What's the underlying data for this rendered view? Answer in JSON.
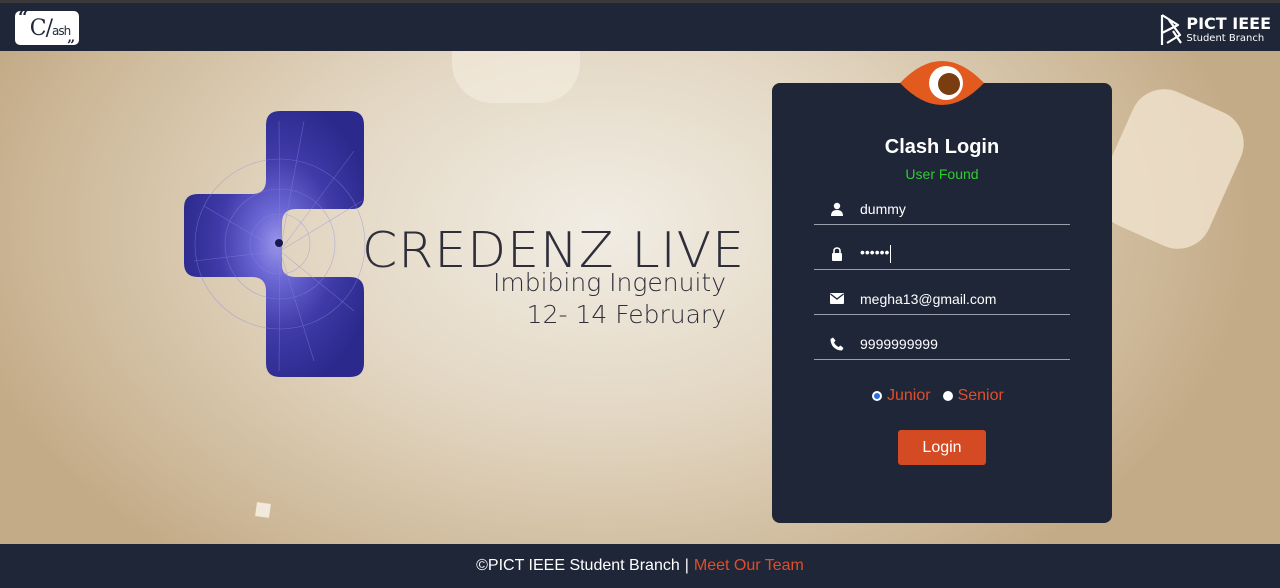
{
  "header": {
    "clash_logo_open_quote": "“",
    "clash_logo_text": "C/",
    "clash_logo_small": "ash",
    "clash_logo_close_quote": "”",
    "ieee_title": "PICT IEEE",
    "ieee_subtitle": "Student Branch"
  },
  "hero": {
    "title": "CREDENZ LIVE",
    "tagline": "Imbibing Ingenuity",
    "dates": "12- 14 February"
  },
  "login": {
    "title": "Clash Login",
    "status": "User Found",
    "username": "dummy",
    "password_masked": "••••••",
    "email": "megha13@gmail.com",
    "phone": "9999999999",
    "radio_options": [
      "Junior",
      "Senior"
    ],
    "selected_option": "Junior",
    "button_label": "Login"
  },
  "footer": {
    "copyright": "©PICT IEEE Student Branch",
    "separator": "|",
    "team_link": "Meet Our Team"
  },
  "colors": {
    "navy": "#1e2638",
    "accent_orange": "#d44a22",
    "link_orange": "#e04e2a",
    "status_green": "#2ece2e"
  }
}
